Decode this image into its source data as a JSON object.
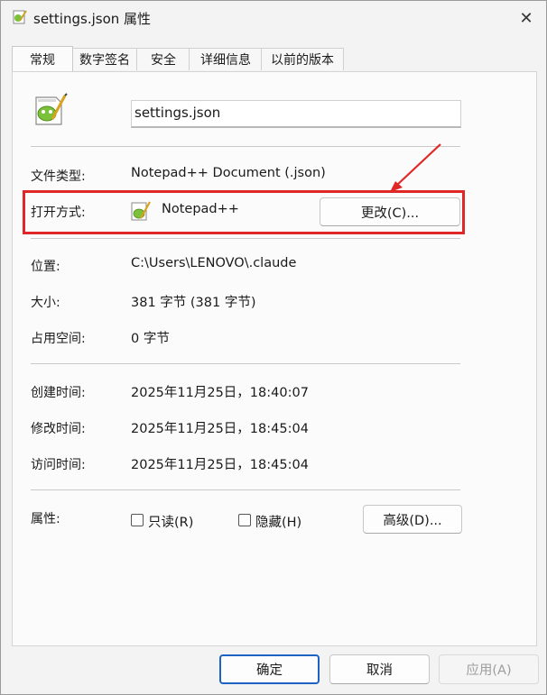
{
  "window": {
    "title": "settings.json 属性",
    "close_glyph": "✕"
  },
  "tabs": [
    {
      "label": "常规",
      "active": true
    },
    {
      "label": "数字签名"
    },
    {
      "label": "安全"
    },
    {
      "label": "详细信息"
    },
    {
      "label": "以前的版本"
    }
  ],
  "general": {
    "file_name": "settings.json",
    "file_type_label": "文件类型:",
    "file_type_value": "Notepad++ Document (.json)",
    "open_with_label": "打开方式:",
    "open_with_app": "Notepad++",
    "change_button": "更改(C)...",
    "location_label": "位置:",
    "location_value": "C:\\Users\\LENOVO\\.claude",
    "size_label": "大小:",
    "size_value": "381 字节 (381 字节)",
    "disk_size_label": "占用空间:",
    "disk_size_value": "0 字节",
    "created_label": "创建时间:",
    "created_value": "2025年11月25日，18:40:07",
    "modified_label": "修改时间:",
    "modified_value": "2025年11月25日，18:45:04",
    "accessed_label": "访问时间:",
    "accessed_value": "2025年11月25日，18:45:04",
    "attributes_label": "属性:",
    "readonly_label": "只读(R)",
    "hidden_label": "隐藏(H)",
    "advanced_button": "高级(D)..."
  },
  "footer": {
    "ok": "确定",
    "cancel": "取消",
    "apply": "应用(A)"
  },
  "colors": {
    "highlight": "#e02727",
    "accent": "#1d63c4"
  },
  "icons": {
    "title": "notepadpp-file-icon",
    "file": "notepadpp-file-icon",
    "app": "notepadpp-app-icon"
  }
}
